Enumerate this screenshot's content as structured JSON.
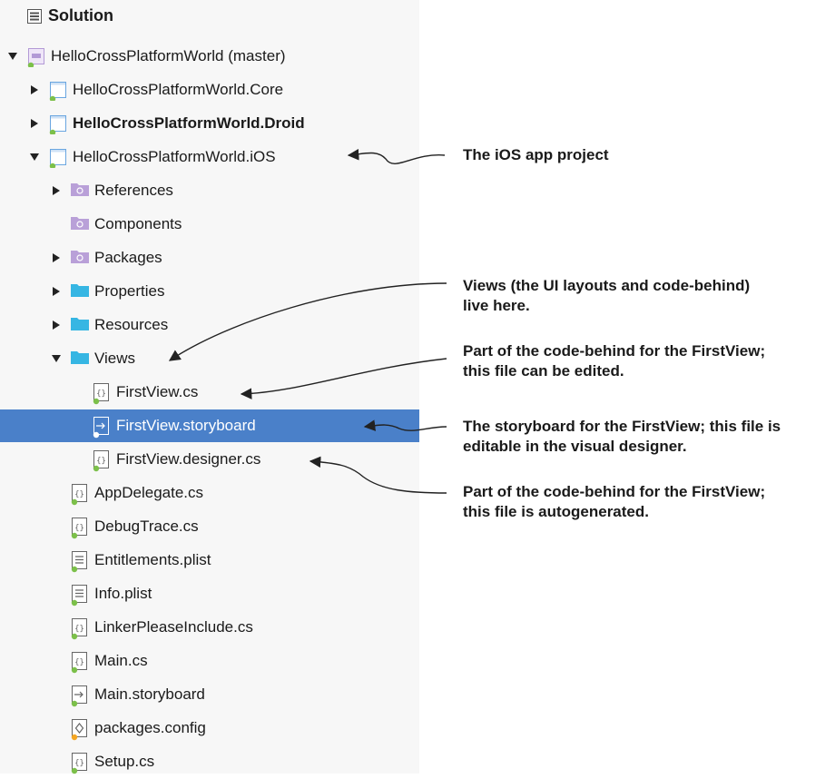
{
  "header": {
    "title": "Solution",
    "icon": "solution-icon"
  },
  "tree": [
    {
      "label": "HelloCrossPlatformWorld (master)",
      "icon": "solution-file-icon",
      "toggle": "expanded"
    },
    {
      "label": "HelloCrossPlatformWorld.Core",
      "icon": "project-icon",
      "toggle": "collapsed"
    },
    {
      "label": "HelloCrossPlatformWorld.Droid",
      "icon": "project-icon",
      "toggle": "collapsed",
      "bold": true
    },
    {
      "label": "HelloCrossPlatformWorld.iOS",
      "icon": "project-icon",
      "toggle": "expanded"
    },
    {
      "label": "References",
      "icon": "references-folder-icon",
      "toggle": "collapsed"
    },
    {
      "label": "Components",
      "icon": "components-folder-icon",
      "toggle": "none"
    },
    {
      "label": "Packages",
      "icon": "packages-folder-icon",
      "toggle": "collapsed"
    },
    {
      "label": "Properties",
      "icon": "folder-icon",
      "toggle": "collapsed"
    },
    {
      "label": "Resources",
      "icon": "folder-icon",
      "toggle": "collapsed"
    },
    {
      "label": "Views",
      "icon": "folder-icon",
      "toggle": "expanded"
    },
    {
      "label": "FirstView.cs",
      "icon": "csharp-file-icon",
      "toggle": "none"
    },
    {
      "label": "FirstView.storyboard",
      "icon": "storyboard-file-icon",
      "toggle": "none",
      "selected": true
    },
    {
      "label": "FirstView.designer.cs",
      "icon": "csharp-file-icon",
      "toggle": "none"
    },
    {
      "label": "AppDelegate.cs",
      "icon": "csharp-file-icon",
      "toggle": "none"
    },
    {
      "label": "DebugTrace.cs",
      "icon": "csharp-file-icon",
      "toggle": "none"
    },
    {
      "label": "Entitlements.plist",
      "icon": "plist-file-icon",
      "toggle": "none"
    },
    {
      "label": "Info.plist",
      "icon": "plist-file-icon",
      "toggle": "none"
    },
    {
      "label": "LinkerPleaseInclude.cs",
      "icon": "csharp-file-icon",
      "toggle": "none"
    },
    {
      "label": "Main.cs",
      "icon": "csharp-file-icon",
      "toggle": "none"
    },
    {
      "label": "Main.storyboard",
      "icon": "storyboard-file-icon",
      "toggle": "none"
    },
    {
      "label": "packages.config",
      "icon": "config-file-icon",
      "toggle": "none"
    },
    {
      "label": "Setup.cs",
      "icon": "csharp-file-icon",
      "toggle": "none"
    }
  ],
  "annotations": {
    "ios_project": "The iOS app project",
    "views_line1": "Views (the UI layouts and code-behind)",
    "views_line2": "live here.",
    "firstview_cs_line1": "Part of the code-behind for the FirstView;",
    "firstview_cs_line2": "this file can be edited.",
    "storyboard_line1": "The storyboard for the FirstView; this file is",
    "storyboard_line2": "editable in the visual designer.",
    "designer_line1": "Part of the code-behind for the FirstView;",
    "designer_line2": "this file is autogenerated."
  },
  "colors": {
    "selection": "#4a80c9",
    "folder": "#36b6e3",
    "special_folder": "#b9a0d8",
    "project_outline": "#6aa6e0",
    "status_dot_green": "#7cc04a",
    "status_dot_orange": "#f5a623"
  }
}
